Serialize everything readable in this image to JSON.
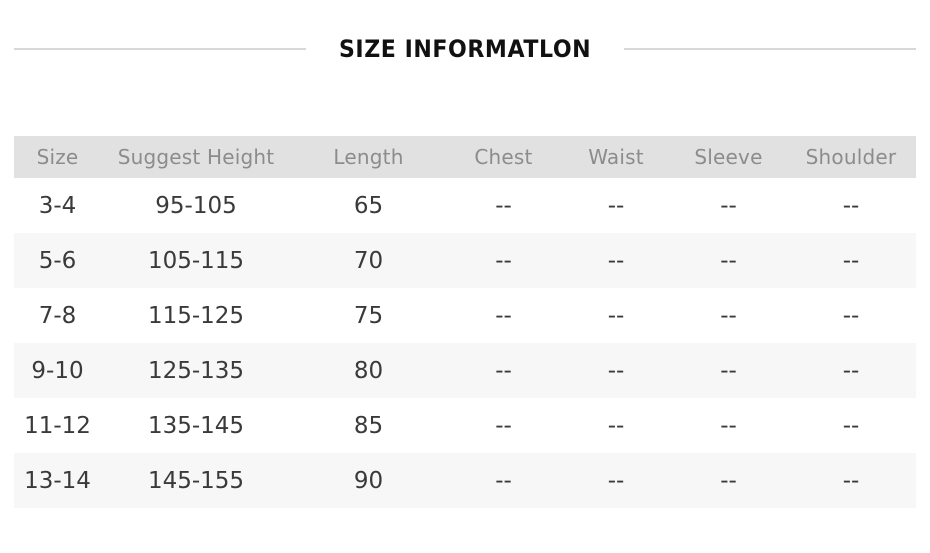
{
  "title": {
    "text": "SIZE INFORMATLON"
  },
  "colors": {
    "header_band": "#e1e1e1",
    "stripe_row": "#f7f7f7",
    "header_text": "#8c8c8c",
    "body_text": "#3a3a3a",
    "rule": "#d8d8d8",
    "title_text": "#111111",
    "page_background": "#ffffff"
  },
  "table": {
    "columns": [
      {
        "key": "size",
        "label": "Size"
      },
      {
        "key": "suggest_height",
        "label": "Suggest Height"
      },
      {
        "key": "length",
        "label": "Length"
      },
      {
        "key": "chest",
        "label": "Chest"
      },
      {
        "key": "waist",
        "label": "Waist"
      },
      {
        "key": "sleeve",
        "label": "Sleeve"
      },
      {
        "key": "shoulder",
        "label": "Shoulder"
      }
    ],
    "rows": [
      {
        "size": "3-4",
        "suggest_height": "95-105",
        "length": "65",
        "chest": "--",
        "waist": "--",
        "sleeve": "--",
        "shoulder": "--"
      },
      {
        "size": "5-6",
        "suggest_height": "105-115",
        "length": "70",
        "chest": "--",
        "waist": "--",
        "sleeve": "--",
        "shoulder": "--"
      },
      {
        "size": "7-8",
        "suggest_height": "115-125",
        "length": "75",
        "chest": "--",
        "waist": "--",
        "sleeve": "--",
        "shoulder": "--"
      },
      {
        "size": "9-10",
        "suggest_height": "125-135",
        "length": "80",
        "chest": "--",
        "waist": "--",
        "sleeve": "--",
        "shoulder": "--"
      },
      {
        "size": "11-12",
        "suggest_height": "135-145",
        "length": "85",
        "chest": "--",
        "waist": "--",
        "sleeve": "--",
        "shoulder": "--"
      },
      {
        "size": "13-14",
        "suggest_height": "145-155",
        "length": "90",
        "chest": "--",
        "waist": "--",
        "sleeve": "--",
        "shoulder": "--"
      }
    ]
  }
}
